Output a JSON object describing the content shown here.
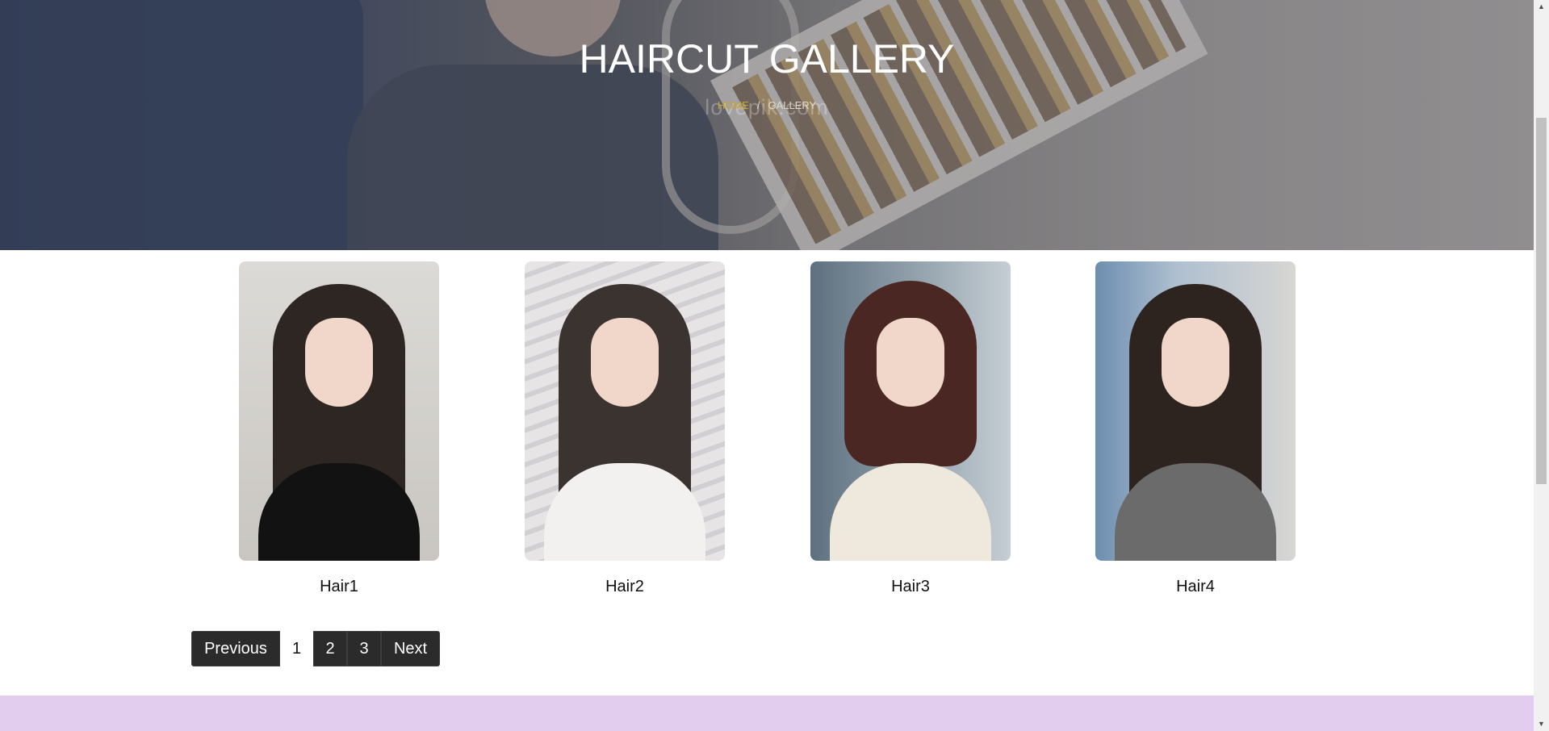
{
  "hero": {
    "title": "HAIRCUT GALLERY",
    "breadcrumb": {
      "home": "HOME",
      "separator": "/",
      "current": "GALLERY"
    },
    "watermark": "lovepik.com"
  },
  "gallery": {
    "items": [
      {
        "label": "Hair1"
      },
      {
        "label": "Hair2"
      },
      {
        "label": "Hair3"
      },
      {
        "label": "Hair4"
      }
    ]
  },
  "pagination": {
    "previous": "Previous",
    "pages": [
      "1",
      "2",
      "3"
    ],
    "current": "1",
    "next": "Next"
  },
  "colors": {
    "breadcrumb_home": "#c9a42a",
    "pagination_bg": "#2b2b2b",
    "footer_band": "#e3cdef"
  },
  "scrollbar": {
    "up_icon": "triangle-up",
    "down_icon": "triangle-down"
  }
}
